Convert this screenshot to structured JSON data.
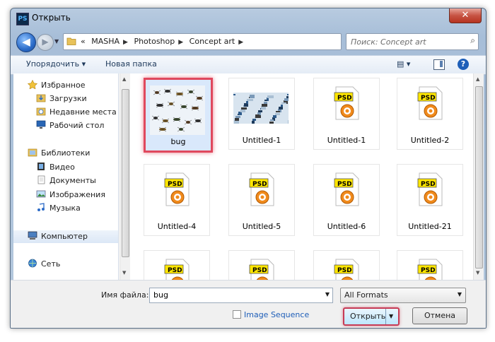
{
  "window": {
    "title": "Открыть",
    "app_icon": "PS",
    "close_glyph": "✕"
  },
  "navigation": {
    "back_glyph": "◀",
    "forward_glyph": "▶",
    "breadcrumb_overflow": "«",
    "breadcrumbs": [
      "MASHA",
      "Photoshop",
      "Concept art"
    ],
    "search_placeholder": "Поиск: Concept art"
  },
  "command_bar": {
    "organize_label": "Упорядочить ▾",
    "new_folder_label": "Новая папка",
    "help_label": "?"
  },
  "nav_pane": {
    "items": [
      {
        "label": "Избранное",
        "icon": "star-icon",
        "kind": "group"
      },
      {
        "label": "Загрузки",
        "icon": "downloads-icon",
        "kind": "child"
      },
      {
        "label": "Недавние места",
        "icon": "recent-places-icon",
        "kind": "child"
      },
      {
        "label": "Рабочий стол",
        "icon": "desktop-icon",
        "kind": "child"
      },
      {
        "label": "Библиотеки",
        "icon": "libraries-icon",
        "kind": "group"
      },
      {
        "label": "Видео",
        "icon": "video-icon",
        "kind": "child"
      },
      {
        "label": "Документы",
        "icon": "documents-icon",
        "kind": "child"
      },
      {
        "label": "Изображения",
        "icon": "pictures-icon",
        "kind": "child"
      },
      {
        "label": "Музыка",
        "icon": "music-icon",
        "kind": "child"
      },
      {
        "label": "Компьютер",
        "icon": "computer-icon",
        "kind": "group"
      },
      {
        "label": "Сеть",
        "icon": "network-icon",
        "kind": "group"
      }
    ]
  },
  "files": {
    "psd_badge": "PSD",
    "items": [
      {
        "name": "bug",
        "type": "image-bugs",
        "selected": true
      },
      {
        "name": "Untitled-1",
        "type": "image-collage",
        "selected": false
      },
      {
        "name": "Untitled-1",
        "type": "psd",
        "selected": false
      },
      {
        "name": "Untitled-2",
        "type": "psd",
        "selected": false
      },
      {
        "name": "Untitled-4",
        "type": "psd",
        "selected": false
      },
      {
        "name": "Untitled-5",
        "type": "psd",
        "selected": false
      },
      {
        "name": "Untitled-6",
        "type": "psd",
        "selected": false
      },
      {
        "name": "Untitled-21",
        "type": "psd",
        "selected": false
      },
      {
        "name": "",
        "type": "psd",
        "selected": false
      },
      {
        "name": "",
        "type": "psd",
        "selected": false
      },
      {
        "name": "",
        "type": "psd",
        "selected": false
      },
      {
        "name": "",
        "type": "psd",
        "selected": false
      }
    ]
  },
  "bottom": {
    "filename_label": "Имя файла:",
    "filename_value": "bug",
    "format_value": "All Formats",
    "image_sequence_label": "Image Sequence",
    "open_label": "Открыть",
    "cancel_label": "Отмена"
  },
  "colors": {
    "selection_outline": "#e0485d",
    "accent": "#1f5fb8"
  }
}
